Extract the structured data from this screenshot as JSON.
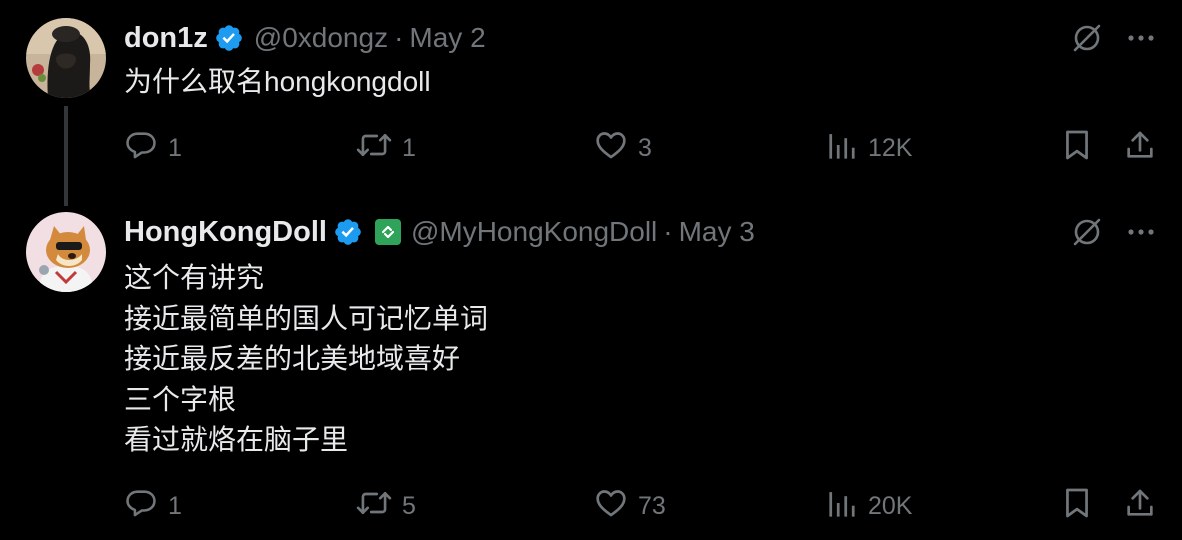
{
  "tweets": [
    {
      "name": "don1z",
      "handle": "@0xdongz",
      "separator": "·",
      "date": "May 2",
      "lines": [
        "为什么取名hongkongdoll"
      ],
      "replies": "1",
      "retweets": "1",
      "likes": "3",
      "views": "12K"
    },
    {
      "name": "HongKongDoll",
      "handle": "@MyHongKongDoll",
      "separator": "·",
      "date": "May 3",
      "lines": [
        "这个有讲究",
        "接近最简单的国人可记忆单词",
        "接近最反差的北美地域喜好",
        "三个字根",
        "看过就烙在脑子里"
      ],
      "replies": "1",
      "retweets": "5",
      "likes": "73",
      "views": "20K"
    }
  ],
  "colors": {
    "background": "#000000",
    "text": "#e7e9ea",
    "secondary": "#71767b",
    "verified": "#1d9bf0",
    "affiliate_badge": "#2fa35a",
    "thread_line": "#333639"
  },
  "icons": {
    "verified": "verified-badge-icon",
    "affiliate": "affiliate-badge-icon",
    "grok": "grok-icon",
    "more": "more-icon",
    "reply": "reply-icon",
    "retweet": "retweet-icon",
    "like": "like-icon",
    "views": "views-icon",
    "bookmark": "bookmark-icon",
    "share": "share-icon"
  }
}
